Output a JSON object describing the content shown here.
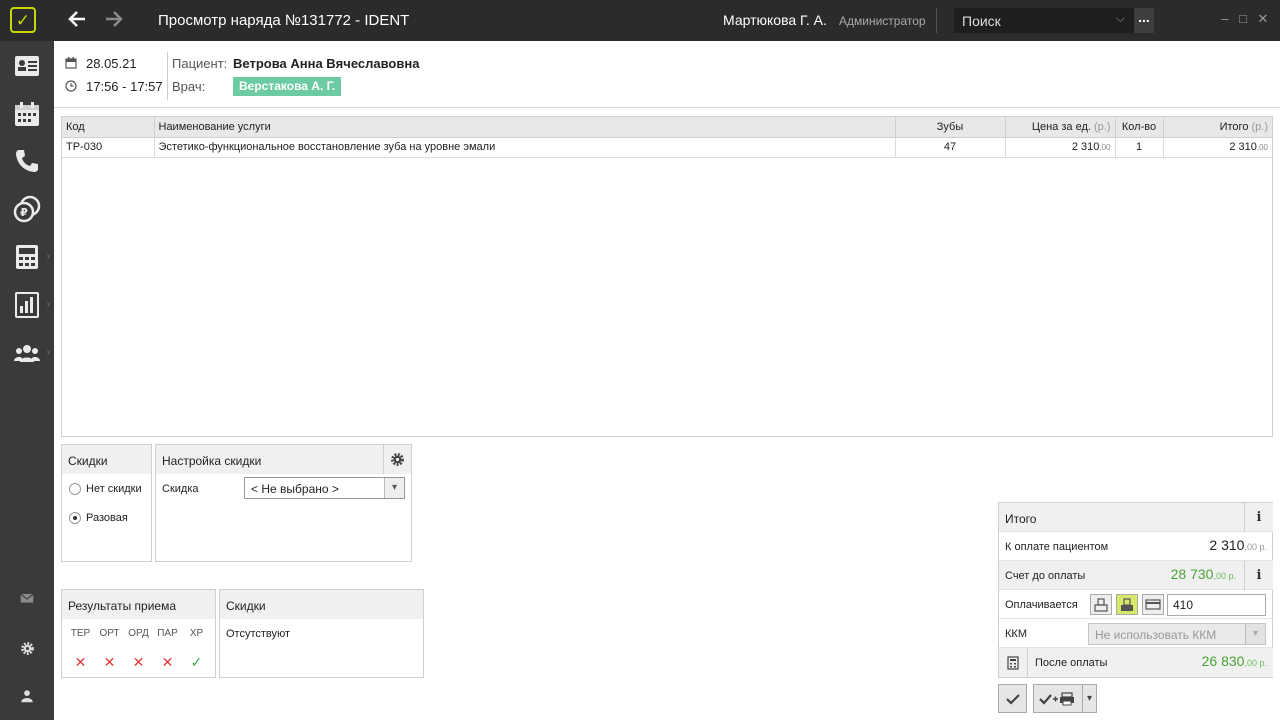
{
  "titlebar": {
    "logo": "✓",
    "title": "Просмотр наряда №131772 - IDENT",
    "user": "Мартюкова Г. А.",
    "role": "Администратор",
    "search_placeholder": "Поиск",
    "more": "...",
    "minimize": "–",
    "maximize": "□",
    "close": "✕"
  },
  "header": {
    "date": "28.05.21",
    "time": "17:56 - 17:57",
    "patient_label": "Пациент:",
    "patient_name": "Ветрова Анна Вячеславовна",
    "doctor_label": "Врач:",
    "doctor_name": "Верстакова А. Г."
  },
  "table": {
    "columns": [
      "Код",
      "Наименование услуги",
      "Зубы",
      "Цена за ед.",
      "Кол-во",
      "Итого"
    ],
    "unit": "(р.)",
    "rows": [
      {
        "code": "ТР-030",
        "name": "Эстетико-функциональное восстановление зуба на уровне эмали",
        "teeth": "47",
        "price_main": "2 310",
        "price_kop": ",00",
        "qty": "1",
        "total_main": "2 310",
        "total_kop": ",00"
      }
    ]
  },
  "discounts": {
    "title": "Скидки",
    "options": [
      "Нет скидки",
      "Разовая"
    ],
    "selected": "Разовая"
  },
  "discount_settings": {
    "title": "Настройка скидки",
    "field_label": "Скидка",
    "field_value": "< Не выбрано >"
  },
  "results": {
    "title": "Результаты приема",
    "columns": [
      "ТЕР",
      "ОРТ",
      "ОРД",
      "ПАР",
      "ХР"
    ],
    "marks": [
      "✕",
      "✕",
      "✕",
      "✕",
      "✓"
    ]
  },
  "discounts_info": {
    "title": "Скидки",
    "text": "Отсутствуют"
  },
  "totals": {
    "title": "Итого",
    "to_pay_label": "К оплате пациентом",
    "to_pay_main": "2 310",
    "to_pay_kop": ",00 р.",
    "account_before_label": "Счет до оплаты",
    "account_before_main": "28 730",
    "account_before_kop": ",00 р.",
    "paying_label": "Оплачивается",
    "paying_value": "410",
    "kkm_label": "ККМ",
    "kkm_value": "Не использовать ККМ",
    "after_label": "После оплаты",
    "after_main": "26 830",
    "after_kop": ",00 р.",
    "info": "i"
  },
  "colors": {
    "accent": "#c8d800",
    "doctor_badge": "#6ccba3",
    "green": "#4aa336",
    "red": "#e03a3a"
  }
}
